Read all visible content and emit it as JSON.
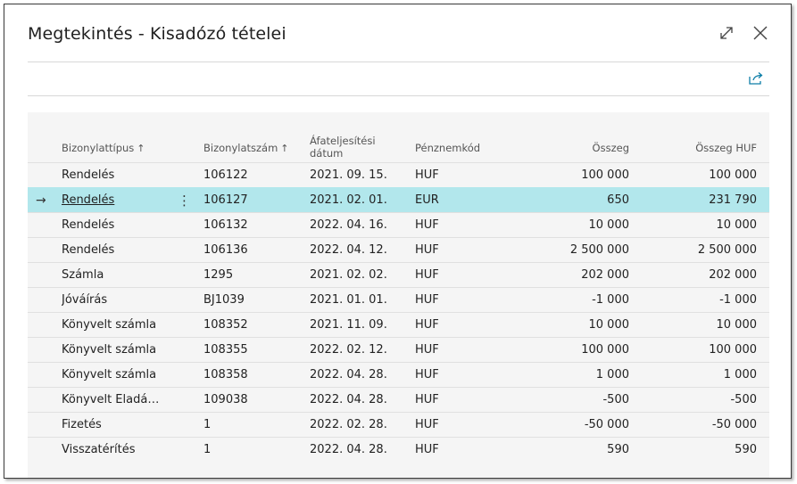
{
  "dialog": {
    "title": "Megtekintés - Kisadózó tételei",
    "icons": {
      "expand": "expand-icon",
      "close": "close-icon",
      "share": "share-icon"
    }
  },
  "table": {
    "columns": [
      {
        "label": "Bizonylattípus",
        "sort": "↑"
      },
      {
        "label": "Bizonylatszám",
        "sort": "↑"
      },
      {
        "label_line1": "Áfateljesítési",
        "label_line2": "dátum"
      },
      {
        "label": "Pénznemkód"
      },
      {
        "label": "Összeg"
      },
      {
        "label": "Összeg HUF"
      }
    ],
    "rows": [
      {
        "type": "Rendelés",
        "number": "106122",
        "date": "2021. 09. 15.",
        "currency": "HUF",
        "amount": "100 000",
        "amount_huf": "100 000"
      },
      {
        "type": "Rendelés",
        "number": "106127",
        "date": "2021. 02. 01.",
        "currency": "EUR",
        "amount": "650",
        "amount_huf": "231 790",
        "selected": true,
        "indicator": "→",
        "menu": "⋮"
      },
      {
        "type": "Rendelés",
        "number": "106132",
        "date": "2022. 04. 16.",
        "currency": "HUF",
        "amount": "10 000",
        "amount_huf": "10 000"
      },
      {
        "type": "Rendelés",
        "number": "106136",
        "date": "2022. 04. 12.",
        "currency": "HUF",
        "amount": "2 500 000",
        "amount_huf": "2 500 000"
      },
      {
        "type": "Számla",
        "number": "1295",
        "date": "2021. 02. 02.",
        "currency": "HUF",
        "amount": "202 000",
        "amount_huf": "202 000"
      },
      {
        "type": "Jóváírás",
        "number": "BJ1039",
        "date": "2021. 01. 01.",
        "currency": "HUF",
        "amount": "-1 000",
        "amount_huf": "-1 000"
      },
      {
        "type": "Könyvelt számla",
        "number": "108352",
        "date": "2021. 11. 09.",
        "currency": "HUF",
        "amount": "10 000",
        "amount_huf": "10 000"
      },
      {
        "type": "Könyvelt számla",
        "number": "108355",
        "date": "2022. 02. 12.",
        "currency": "HUF",
        "amount": "100 000",
        "amount_huf": "100 000"
      },
      {
        "type": "Könyvelt számla",
        "number": "108358",
        "date": "2022. 04. 28.",
        "currency": "HUF",
        "amount": "1 000",
        "amount_huf": "1 000"
      },
      {
        "type": "Könyvelt Eladási...",
        "number": "109038",
        "date": "2022. 04. 28.",
        "currency": "HUF",
        "amount": "-500",
        "amount_huf": "-500"
      },
      {
        "type": "Fizetés",
        "number": "1",
        "date": "2022. 02. 28.",
        "currency": "HUF",
        "amount": "-50 000",
        "amount_huf": "-50 000"
      },
      {
        "type": "Visszatérítés",
        "number": "1",
        "date": "2022. 04. 28.",
        "currency": "HUF",
        "amount": "590",
        "amount_huf": "590"
      }
    ]
  },
  "colors": {
    "selected_row": "#b2e7ec",
    "accent": "#0d7ea8"
  }
}
